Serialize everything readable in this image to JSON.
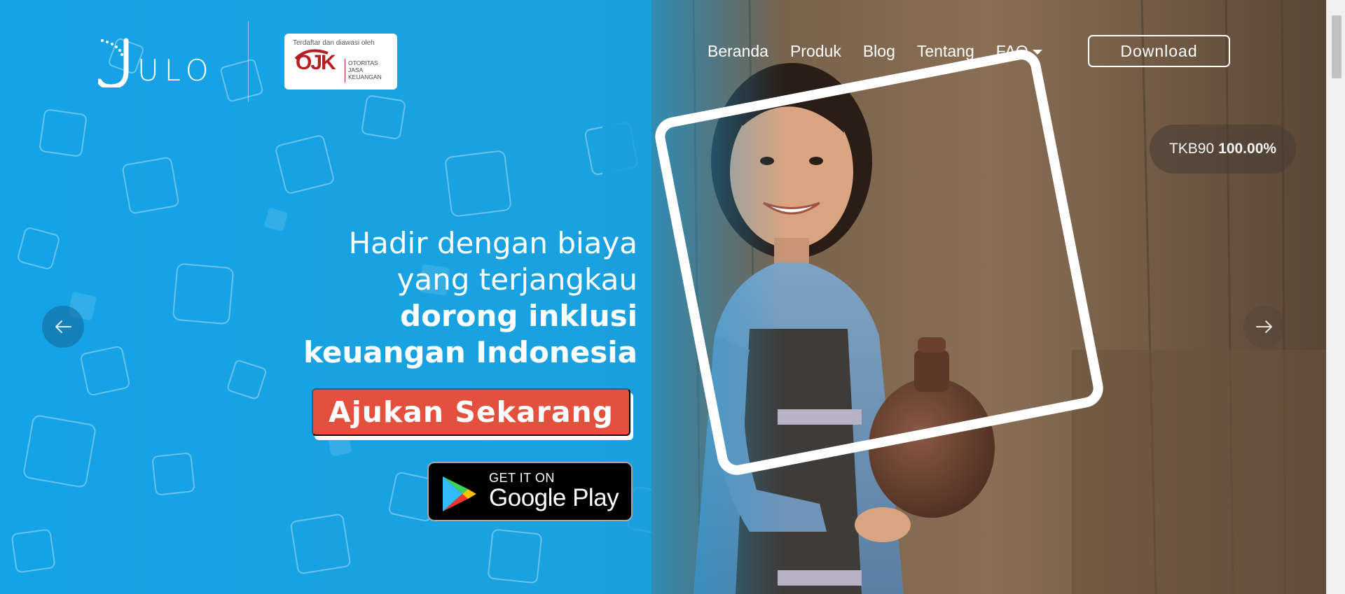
{
  "brand": {
    "logo_text": "ULO",
    "logo_icon": "julo-j-icon"
  },
  "ojk": {
    "caption": "Terdaftar dan diawasi oleh",
    "mark": "OJK",
    "name_lines": [
      "OTORITAS",
      "JASA",
      "KEUANGAN"
    ],
    "color": "#b51f24"
  },
  "nav": {
    "items": [
      "Beranda",
      "Produk",
      "Blog",
      "Tentang"
    ],
    "faq": "FAQ",
    "download": "Download"
  },
  "tkb": {
    "label": "TKB90",
    "value": "100.00%"
  },
  "hero": {
    "line1": "Hadir dengan biaya",
    "line2": "yang terjangkau",
    "line3": "dorong inklusi",
    "line4": "keuangan Indonesia",
    "cta": "Ajukan Sekarang",
    "cta_color": "#e3513e"
  },
  "google_play": {
    "small": "GET IT ON",
    "big": "Google Play"
  },
  "carousel": {
    "prev_icon": "arrow-left-icon",
    "next_icon": "arrow-right-icon"
  },
  "colors": {
    "hero_blue": "#14a3e6"
  }
}
